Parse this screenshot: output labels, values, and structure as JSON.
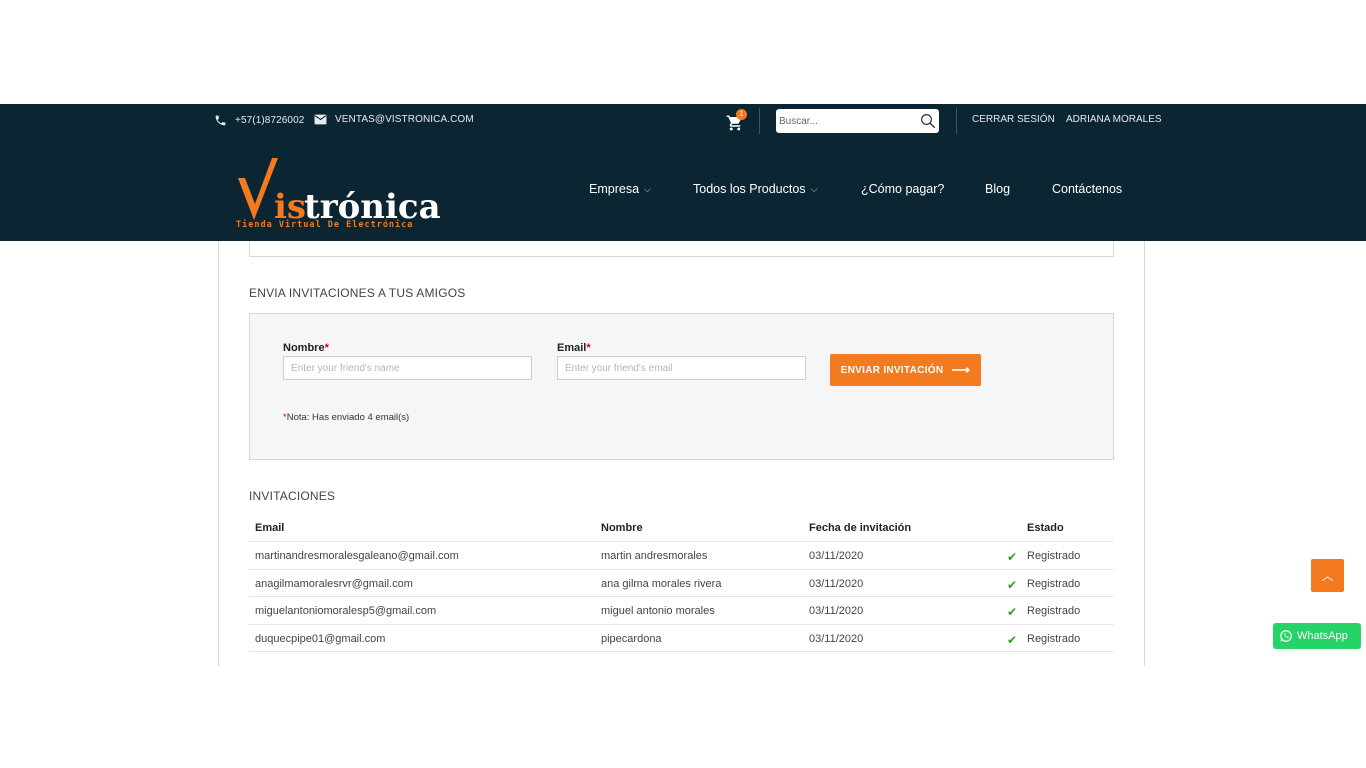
{
  "topbar": {
    "phone": "+57(1)8726002",
    "email": "VENTAS@VISTRONICA.COM",
    "cart_count": "1",
    "search_placeholder": "Buscar...",
    "logout": "CERRAR SESIÓN",
    "username": "ADRIANA MORALES"
  },
  "logo": {
    "brand": "Vistrónica",
    "tagline": "Tienda Virtual De Electrónica"
  },
  "nav": {
    "items": [
      {
        "label": "Empresa",
        "has_dropdown": true
      },
      {
        "label": "Todos los Productos",
        "has_dropdown": true
      },
      {
        "label": "¿Cómo pagar?",
        "has_dropdown": false
      },
      {
        "label": "Blog",
        "has_dropdown": false
      },
      {
        "label": "Contáctenos",
        "has_dropdown": false
      }
    ],
    "chevron": "⌵"
  },
  "invite": {
    "title": "ENVIA INVITACIONES A TUS AMIGOS",
    "name_label": "Nombre",
    "email_label": "Email",
    "required_mark": "*",
    "name_placeholder": "Enter your friend's name",
    "email_placeholder": "Enter your friend's email",
    "send_label": "ENVIAR INVITACIÓN",
    "send_arrow": "⟶",
    "note_mark": "*",
    "note": "Nota: Has enviado 4 email(s)"
  },
  "invitations": {
    "title": "INVITACIONES",
    "columns": [
      "Email",
      "Nombre",
      "Fecha de invitación",
      "Estado"
    ],
    "rows": [
      {
        "email": "martinandresmoralesgaleano@gmail.com",
        "name": "martin andresmorales",
        "date": "03/11/2020",
        "status": "Registrado"
      },
      {
        "email": "anagilmamoralesrvr@gmail.com",
        "name": "ana gilma morales rivera",
        "date": "03/11/2020",
        "status": "Registrado"
      },
      {
        "email": "miguelantoniomoralesp5@gmail.com",
        "name": "miguel antonio morales",
        "date": "03/11/2020",
        "status": "Registrado"
      },
      {
        "email": "duquecpipe01@gmail.com",
        "name": "pipecardona",
        "date": "03/11/2020",
        "status": "Registrado"
      }
    ],
    "check_glyph": "✔"
  },
  "floating": {
    "to_top_glyph": "︿",
    "whatsapp_label": "WhatsApp"
  },
  "colors": {
    "header_bg": "#0c2533",
    "accent_orange": "#f47a20",
    "check_green": "#2aa31c",
    "whatsapp_green": "#25d366"
  }
}
